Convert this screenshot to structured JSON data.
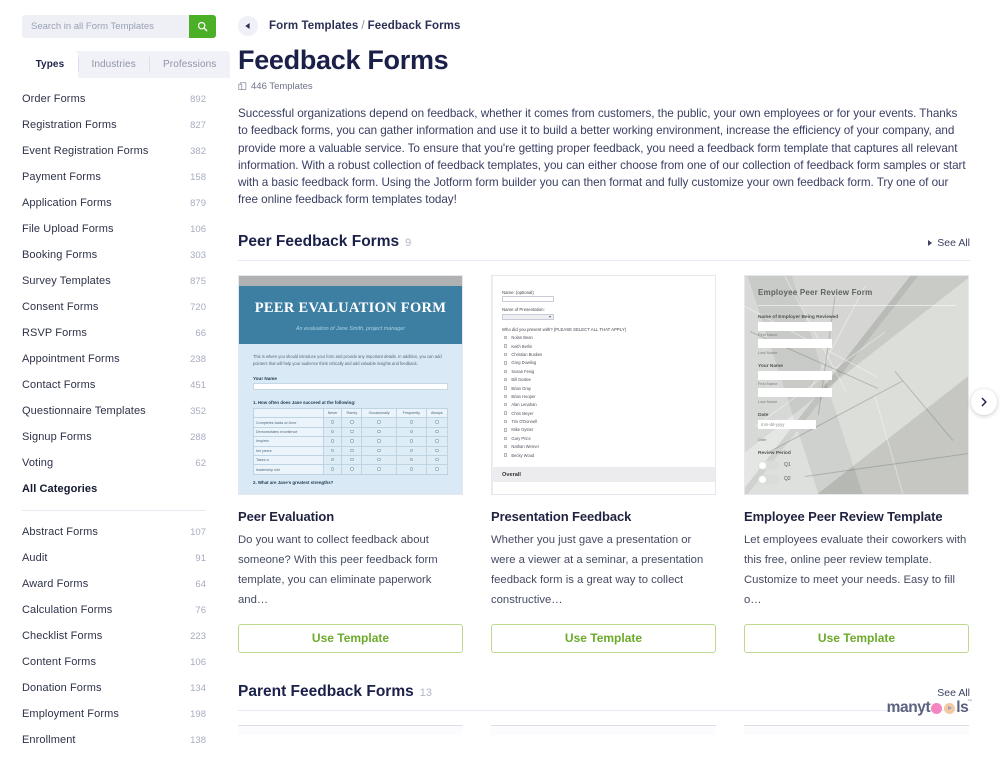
{
  "search": {
    "placeholder": "Search in all Form Templates",
    "value": "",
    "button_icon": "search-icon"
  },
  "tabs": [
    {
      "label": "Types",
      "active": true
    },
    {
      "label": "Industries",
      "active": false
    },
    {
      "label": "Professions",
      "active": false
    }
  ],
  "sidebar": {
    "primary_categories": [
      {
        "label": "Order Forms",
        "count": "892"
      },
      {
        "label": "Registration Forms",
        "count": "827"
      },
      {
        "label": "Event Registration Forms",
        "count": "382"
      },
      {
        "label": "Payment Forms",
        "count": "158"
      },
      {
        "label": "Application Forms",
        "count": "879"
      },
      {
        "label": "File Upload Forms",
        "count": "106"
      },
      {
        "label": "Booking Forms",
        "count": "303"
      },
      {
        "label": "Survey Templates",
        "count": "875"
      },
      {
        "label": "Consent Forms",
        "count": "720"
      },
      {
        "label": "RSVP Forms",
        "count": "66"
      },
      {
        "label": "Appointment Forms",
        "count": "238"
      },
      {
        "label": "Contact Forms",
        "count": "451"
      },
      {
        "label": "Questionnaire Templates",
        "count": "352"
      },
      {
        "label": "Signup Forms",
        "count": "288"
      },
      {
        "label": "Voting",
        "count": "62"
      }
    ],
    "all_categories_label": "All Categories",
    "secondary_categories": [
      {
        "label": "Abstract Forms",
        "count": "107"
      },
      {
        "label": "Audit",
        "count": "91"
      },
      {
        "label": "Award Forms",
        "count": "64"
      },
      {
        "label": "Calculation Forms",
        "count": "76"
      },
      {
        "label": "Checklist Forms",
        "count": "223"
      },
      {
        "label": "Content Forms",
        "count": "106"
      },
      {
        "label": "Donation Forms",
        "count": "134"
      },
      {
        "label": "Employment Forms",
        "count": "198"
      },
      {
        "label": "Enrollment",
        "count": "138"
      }
    ]
  },
  "header": {
    "back_icon": "back-arrow-icon",
    "breadcrumb_root": "Form Templates",
    "breadcrumb_separator": "/",
    "breadcrumb_current": "Feedback Forms",
    "title": "Feedback Forms",
    "templates_icon": "copy-icon",
    "templates_count": "446 Templates",
    "description": "Successful organizations depend on feedback, whether it comes from customers, the public, your own employees or for your events. Thanks to feedback forms, you can gather information and use it to build a better working environment, increase the efficiency of your company, and provide more a valuable service. To ensure that you're getting proper feedback, you need a feedback form template that captures all relevant information. With a robust collection of feedback templates, you can either choose from one of our collection of feedback form samples or start with a basic feedback form. Using the Jotform form builder you can then format and fully customize your own feedback form. Try one of our free online feedback form templates today!"
  },
  "sections": [
    {
      "title": "Peer Feedback Forms",
      "count": "9",
      "see_all": "See All",
      "cards": [
        {
          "title": "Peer Evaluation",
          "description": "Do you want to collect feedback about someone? With this peer feedback form template, you can eliminate paperwork and…",
          "button": "Use Template",
          "thumb": {
            "kind": "peer-evaluation",
            "heading": "PEER EVALUATION FORM",
            "subheading": "An evaluation of Jane Smith, project manager",
            "intro": "This is where you should introduce your form and provide any important details. In addition, you can add pointers that will help your audience think critically and add valuable insights and feedback.",
            "field_label": "Your Name",
            "question": "1. How often does Jane succeed at the following:",
            "columns": [
              "Never",
              "Rarely",
              "Occasionally",
              "Frequently",
              "Always"
            ],
            "rows": [
              "Completes tasks on time",
              "Demonstrates excellence",
              "Inspires",
              "her peers",
              "Takes a",
              "leadership role"
            ],
            "question2": "2. What are Jane's greatest strengths?"
          }
        },
        {
          "title": "Presentation Feedback",
          "description": "Whether you just gave a presentation or were a viewer at a seminar, a presentation feedback form is a great way to collect constructive…",
          "button": "Use Template",
          "thumb": {
            "kind": "presentation-feedback",
            "name_label": "Name: (optional)",
            "presentation_label": "Name of Presentation:",
            "question": "Who did you present with? (PLEASE SELECT ALL THAT APPLY)",
            "options": [
              "Nolan Bean",
              "Keith Berlin",
              "Christian Busken",
              "Greg Dowling",
              "Susan Fesig",
              "Bill Goslee",
              "Brian Gray",
              "Brian Hooper",
              "Alan Lenahan",
              "Chris Meyer",
              "Tim O'Donnell",
              "Mike Oyster",
              "Gary Price",
              "Nathan Werner",
              "Becky Wood"
            ],
            "overall_label": "Overall"
          }
        },
        {
          "title": "Employee Peer Review Template",
          "description": "Let employees evaluate their coworkers with this free, online peer review template. Customize to meet your needs. Easy to fill o…",
          "button": "Use Template",
          "thumb": {
            "kind": "employee-peer-review",
            "heading": "Employee Peer Review Form",
            "field1_label": "Name of Employer Being Reviewed",
            "field1_sub1": "First Name",
            "field1_sub2": "Last Name",
            "field2_label": "Your Name",
            "field2_sub1": "First Name",
            "field2_sub2": "Last Name",
            "date_label": "Date",
            "date_placeholder": "mm-dd-yyyy",
            "date_sub": "Date",
            "review_period_label": "Review Period",
            "toggles": [
              "Q1",
              "Q2"
            ]
          }
        }
      ],
      "next_arrow_icon": "chevron-right-icon"
    },
    {
      "title": "Parent Feedback Forms",
      "count": "13",
      "see_all": "See All",
      "cards": []
    }
  ],
  "watermark": {
    "text_part1": "manyt",
    "text_part2": "ls",
    "trademark": "™"
  },
  "colors": {
    "accent_green": "#4caf28",
    "button_green": "#6cab2a",
    "title_navy": "#1b2049",
    "muted": "#a7acc0"
  }
}
